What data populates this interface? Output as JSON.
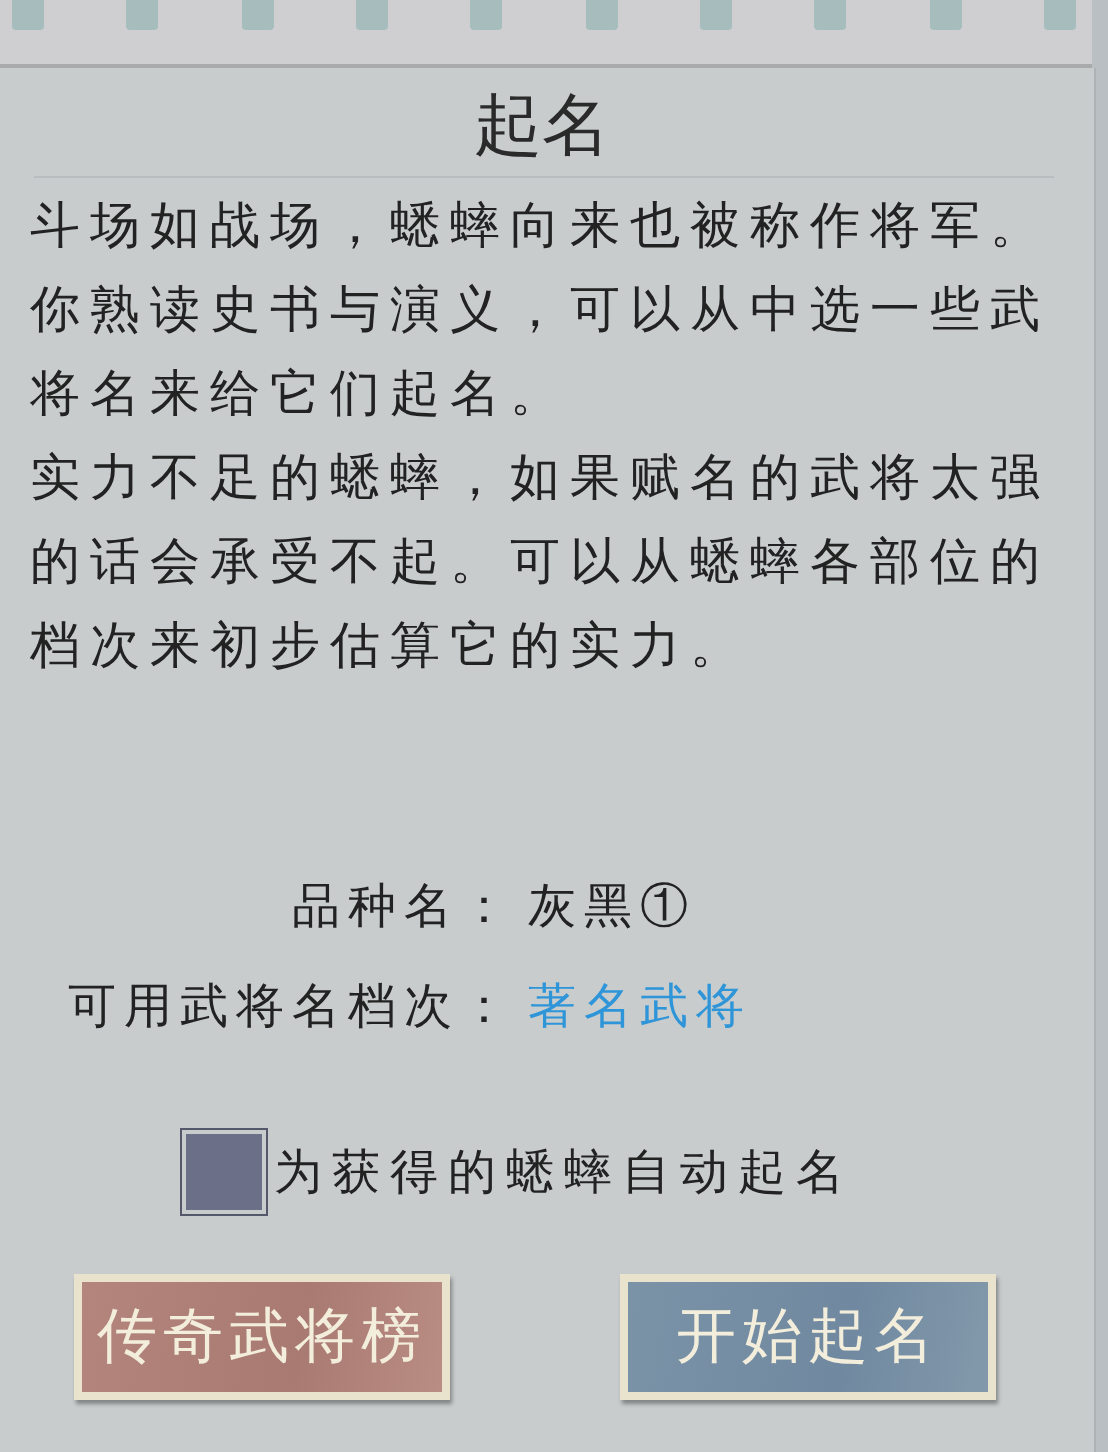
{
  "title": "起名",
  "paragraphs": [
    "斗场如战场，蟋蟀向来也被称作将军。你熟读史书与演义，可以从中选一些武将名来给它们起名。",
    "实力不足的蟋蟀，如果赋名的武将太强的话会承受不起。可以从蟋蟀各部位的档次来初步估算它的实力。"
  ],
  "fields": [
    {
      "label": "品种名：",
      "value": "灰黑①",
      "kind": "plain"
    },
    {
      "label": "可用武将名档次：",
      "value": "著名武将",
      "kind": "highlight"
    }
  ],
  "auto_name": {
    "label": "为获得的蟋蟀自动起名",
    "checked": false
  },
  "buttons": [
    {
      "label": "传奇武将榜",
      "kind": "secondary"
    },
    {
      "label": "开始起名",
      "kind": "primary"
    }
  ]
}
